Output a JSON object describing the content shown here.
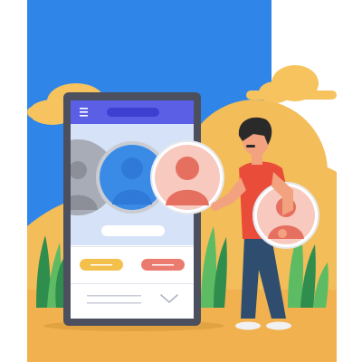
{
  "illustration": {
    "subject": "person-choosing-profile-in-phone-app",
    "icons": [
      "menu-icon",
      "chevron-down-icon",
      "user-avatar-icon"
    ]
  },
  "colors": {
    "sky": "#2f86e8",
    "sun": "#f3bd5a",
    "sand": "#f1b14f",
    "cloud": "#f6c35e",
    "phone_frame": "#4b4f5e",
    "phone_screen": "#ffffff",
    "app_header": "#5a5fe6",
    "app_header_pill": "#3d3fd0",
    "profile_panel": "#d6e2f7",
    "avatar_gray": "#a8acb6",
    "avatar_blue": "#3a8be6",
    "avatar_red": "#ea8a7a",
    "button_yellow": "#f4c04c",
    "button_red": "#ec7b6f",
    "shirt": "#ea4c3a",
    "pants": "#2f4d6f",
    "hair": "#2b2a2a",
    "skin": "#f2a27e",
    "plants_light": "#5dbb63",
    "plants_dark": "#2f8d4e"
  }
}
